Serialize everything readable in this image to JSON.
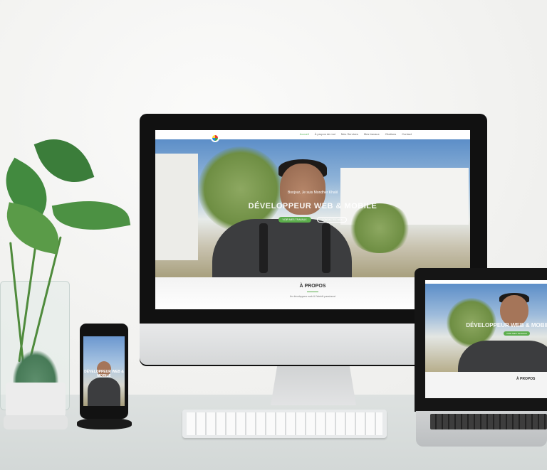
{
  "scene": {
    "description_label": "Responsive website mockup on iMac, laptop and phone"
  },
  "website": {
    "nav": {
      "items": [
        {
          "label": "Accueil",
          "active": true
        },
        {
          "label": "À propos de moi",
          "active": false
        },
        {
          "label": "Mes Services",
          "active": false
        },
        {
          "label": "Mes travaux",
          "active": false
        },
        {
          "label": "Citations",
          "active": false
        },
        {
          "label": "Contact",
          "active": false
        }
      ]
    },
    "hero": {
      "subtitle": "Bonjour, Je suis Mondher Khalil",
      "title": "DÉVELOPPEUR WEB & MOBILE",
      "primary_button": "VOIR MES TRAVAUX",
      "secondary_button": "CONTACTEZ-MOI"
    },
    "about": {
      "title": "À PROPOS",
      "text": "Un développeur web & l'intérêt passionné"
    }
  },
  "phone": {
    "hero_title": "DÉVELOPPEUR WEB & MOBILE"
  },
  "laptop": {
    "hero_title": "DÉVELOPPEUR WEB & MOBILE",
    "about_title": "À PROPOS"
  },
  "colors": {
    "accent_green": "#5cae4c",
    "device_black": "#111111",
    "wall": "#f2f2f0"
  }
}
